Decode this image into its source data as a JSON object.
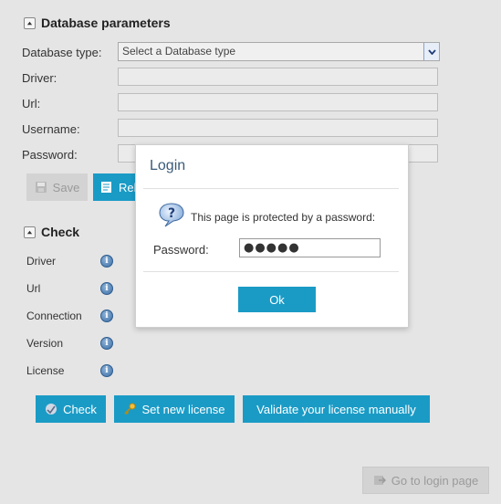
{
  "db_params": {
    "title": "Database parameters",
    "type_label": "Database type:",
    "type_placeholder": "Select a Database type",
    "driver_label": "Driver:",
    "url_label": "Url:",
    "username_label": "Username:",
    "password_label": "Password:",
    "save_label": "Save",
    "reload_label": "Rel"
  },
  "check": {
    "title": "Check",
    "rows": [
      "Driver",
      "Url",
      "Connection",
      "Version",
      "License"
    ],
    "check_button": "Check",
    "set_license_button": "Set new license",
    "validate_button": "Validate your license manually"
  },
  "footer": {
    "login_page_label": "Go to login page"
  },
  "dialog": {
    "title": "Login",
    "message": "This page is protected by a password:",
    "password_label": "Password:",
    "password_value": "●●●●●",
    "ok_label": "Ok"
  },
  "colors": {
    "accent": "#1a9bc6",
    "background": "#e5e5e5"
  }
}
